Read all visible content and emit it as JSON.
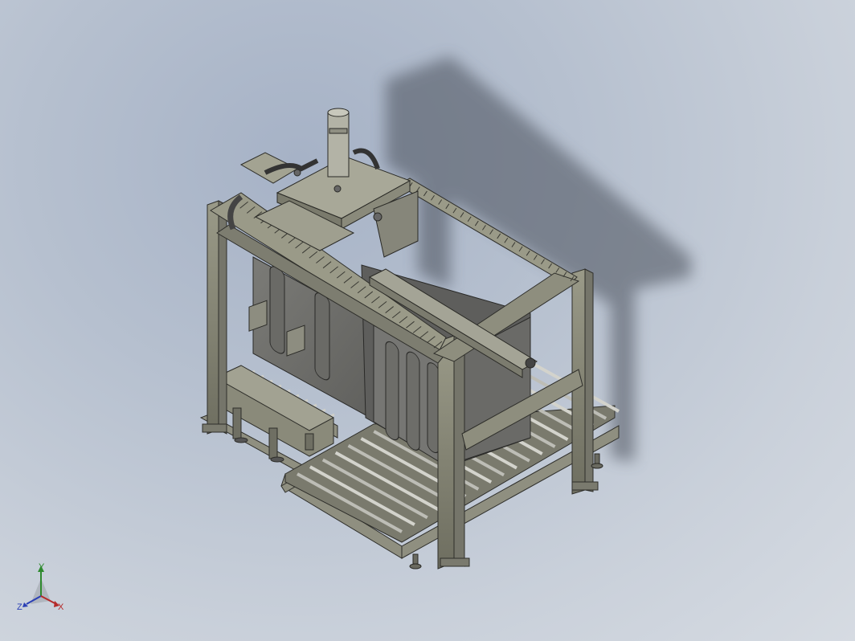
{
  "viewport": {
    "background_top": "#a6b2c6",
    "background_bottom": "#d6dbe2"
  },
  "model": {
    "frame_color": "#8a8a78",
    "panel_color": "#6f6f6c",
    "roller_color": "#c9c9c4",
    "shadow_color": "#4a4f5a"
  },
  "triad": {
    "y_label": "Y",
    "z_label": "Z",
    "x_label": "X",
    "y_color": "#2e8a2e",
    "z_color": "#2a3fb5",
    "x_color": "#b52a2a"
  }
}
